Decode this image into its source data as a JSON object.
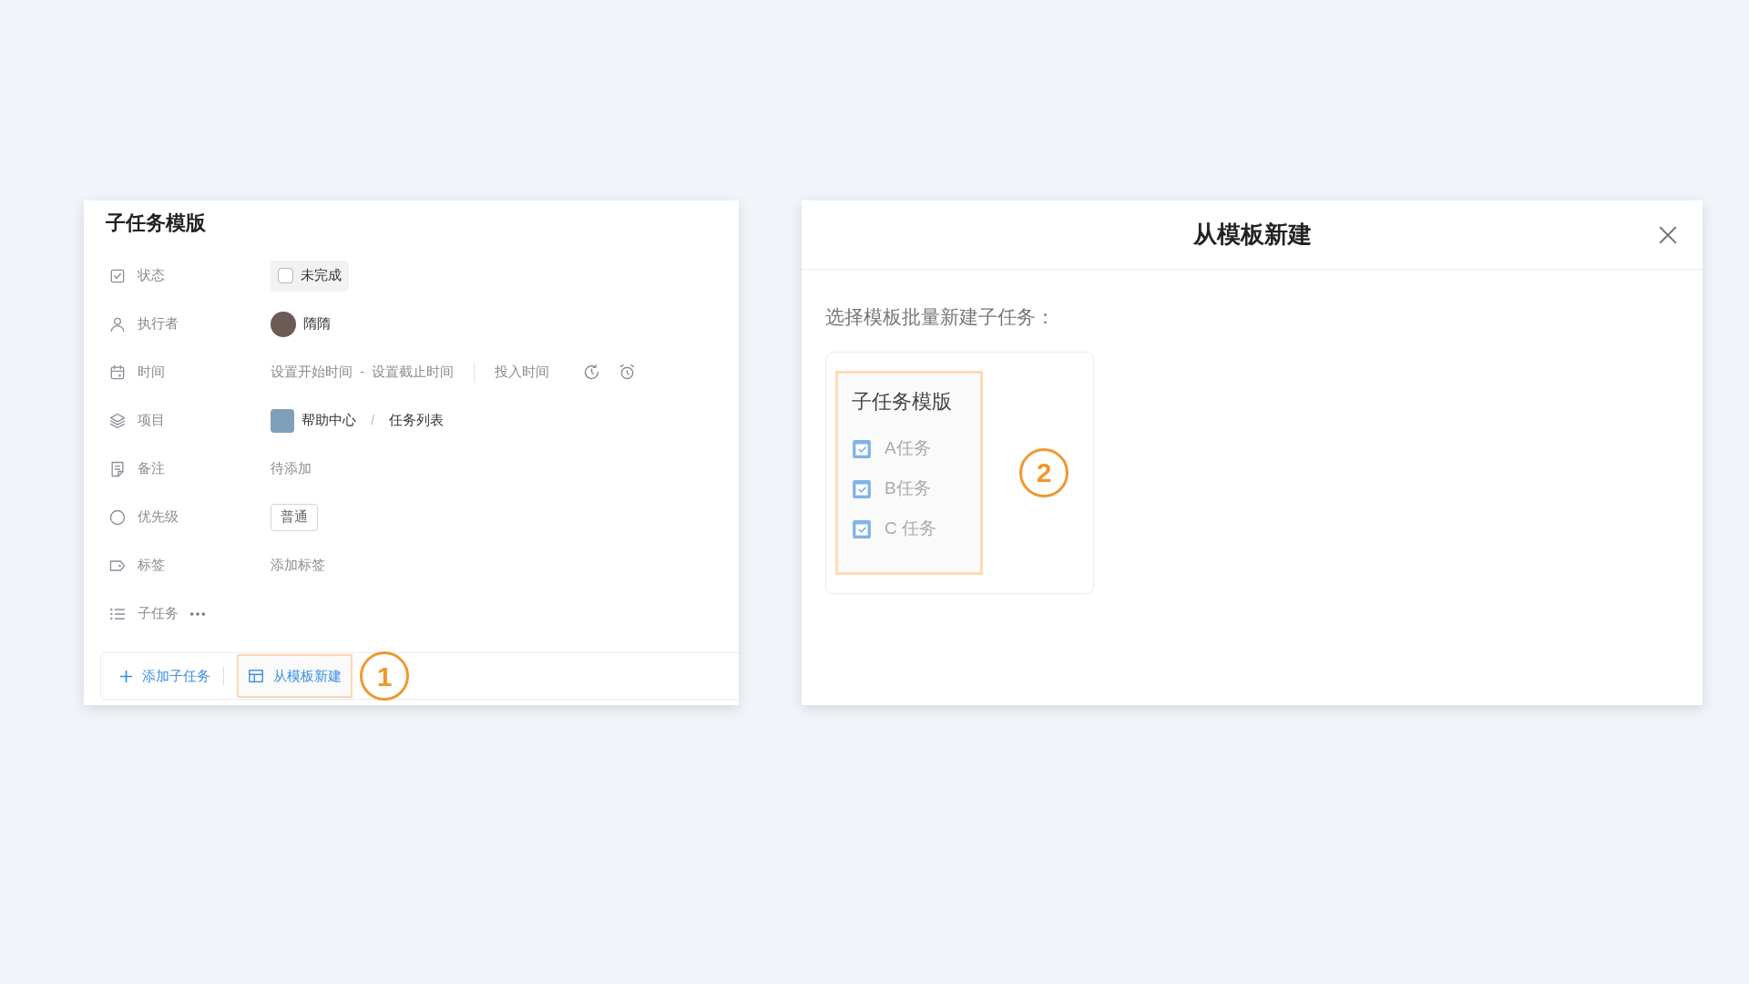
{
  "task_panel": {
    "title": "子任务模版",
    "fields": [
      {
        "kind": "status",
        "label": "状态",
        "checkbox": {
          "label": "未完成",
          "checked": false
        }
      },
      {
        "kind": "assignee",
        "label": "执行者",
        "name": "隋隋"
      },
      {
        "kind": "time",
        "label": "时间",
        "start": "设置开始时间",
        "separator": "-",
        "end": "设置截止时间",
        "effort": "投入时间"
      },
      {
        "kind": "project",
        "label": "项目",
        "project": "帮助中心",
        "divider": "/",
        "list": "任务列表"
      },
      {
        "kind": "note",
        "label": "备注",
        "value": "待添加"
      },
      {
        "kind": "priority",
        "label": "优先级",
        "value": "普通"
      },
      {
        "kind": "tags",
        "label": "标签",
        "value": "添加标签"
      },
      {
        "kind": "subtasks",
        "label": "子任务"
      }
    ],
    "footer": {
      "add_button": "添加子任务",
      "template_button": "从模板新建",
      "callout": "1"
    }
  },
  "template_dialog": {
    "title": "从模板新建",
    "prompt": "选择模板批量新建子任务：",
    "template": {
      "title": "子任务模版",
      "items": [
        {
          "label": "A任务",
          "checked": true
        },
        {
          "label": "B任务",
          "checked": true
        },
        {
          "label": "C 任务",
          "checked": true
        }
      ]
    },
    "callout": "2"
  }
}
